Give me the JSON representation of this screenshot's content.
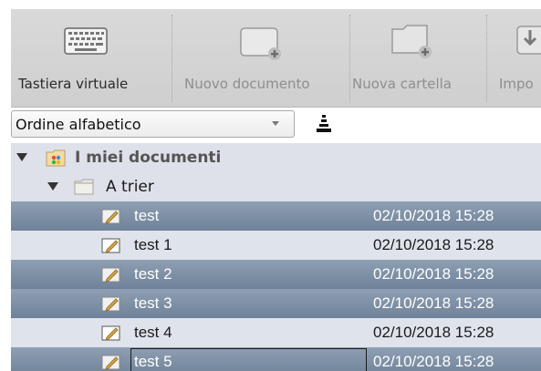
{
  "toolbar": {
    "buttons": [
      {
        "label": "Tastiera virtuale",
        "icon": "keyboard-icon",
        "enabled": true
      },
      {
        "label": "Nuovo documento",
        "icon": "new-document-icon",
        "enabled": false
      },
      {
        "label": "Nuova cartella",
        "icon": "new-folder-icon",
        "enabled": false
      },
      {
        "label": "Impo",
        "icon": "import-icon",
        "enabled": false
      }
    ]
  },
  "sort": {
    "selected": "Ordine alfabetico",
    "order_icon": "sort-order-icon"
  },
  "tree": {
    "root": {
      "label": "I miei documenti",
      "icon": "my-documents-icon"
    },
    "folder": {
      "label": "A trier",
      "icon": "folder-icon"
    },
    "items": [
      {
        "name": "test",
        "date": "02/10/2018 15:28",
        "style": "dark"
      },
      {
        "name": "test 1",
        "date": "02/10/2018 15:28",
        "style": "lite"
      },
      {
        "name": "test 2",
        "date": "02/10/2018 15:28",
        "style": "dark"
      },
      {
        "name": "test 3",
        "date": "02/10/2018 15:28",
        "style": "dark"
      },
      {
        "name": "test 4",
        "date": "02/10/2018 15:28",
        "style": "lite"
      },
      {
        "name": "test 5",
        "date": "02/10/2018 15:28",
        "style": "dark",
        "focused": true
      }
    ]
  },
  "colors": {
    "selected_row": "#7d8ea4",
    "group_row": "#dee1ea",
    "toolbar_bg": "#d4d4d4"
  }
}
